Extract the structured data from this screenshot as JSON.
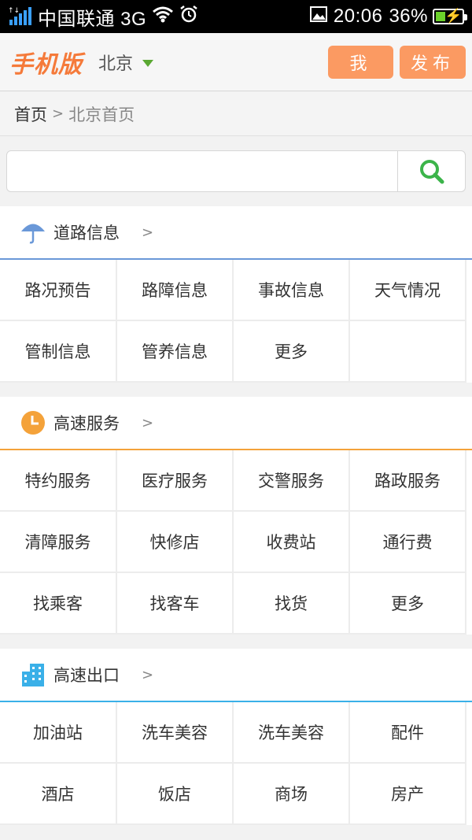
{
  "status_bar": {
    "carrier": "中国联通 3G",
    "time": "20:06",
    "battery": "36%",
    "battery_level": 0.36,
    "icons": [
      "signal-icon",
      "wifi-icon",
      "alarm-icon",
      "image-icon",
      "battery-charging-icon"
    ]
  },
  "header": {
    "logo": "手机版",
    "city": "北京",
    "me_button": "我",
    "post_button": "发布"
  },
  "breadcrumb": {
    "home": "首页",
    "separator": ">",
    "current": "北京首页"
  },
  "search": {
    "value": "",
    "placeholder": "",
    "button_icon": "search-icon"
  },
  "sections": [
    {
      "title": "道路信息",
      "arrow": ">",
      "icon": "umbrella-icon",
      "accent": "#6a98d8",
      "items": [
        "路况预告",
        "路障信息",
        "事故信息",
        "天气情况",
        "管制信息",
        "管养信息",
        "更多"
      ]
    },
    {
      "title": "高速服务",
      "arrow": ">",
      "icon": "clock-icon",
      "accent": "#f4a23a",
      "items": [
        "特约服务",
        "医疗服务",
        "交警服务",
        "路政服务",
        "清障服务",
        "快修店",
        "收费站",
        "通行费",
        "找乘客",
        "找客车",
        "找货",
        "更多"
      ]
    },
    {
      "title": "高速出口",
      "arrow": ">",
      "icon": "building-icon",
      "accent": "#3ab0e8",
      "items": [
        "加油站",
        "洗车美容",
        "洗车美容",
        "配件",
        "酒店",
        "饭店",
        "商场",
        "房产"
      ]
    }
  ]
}
